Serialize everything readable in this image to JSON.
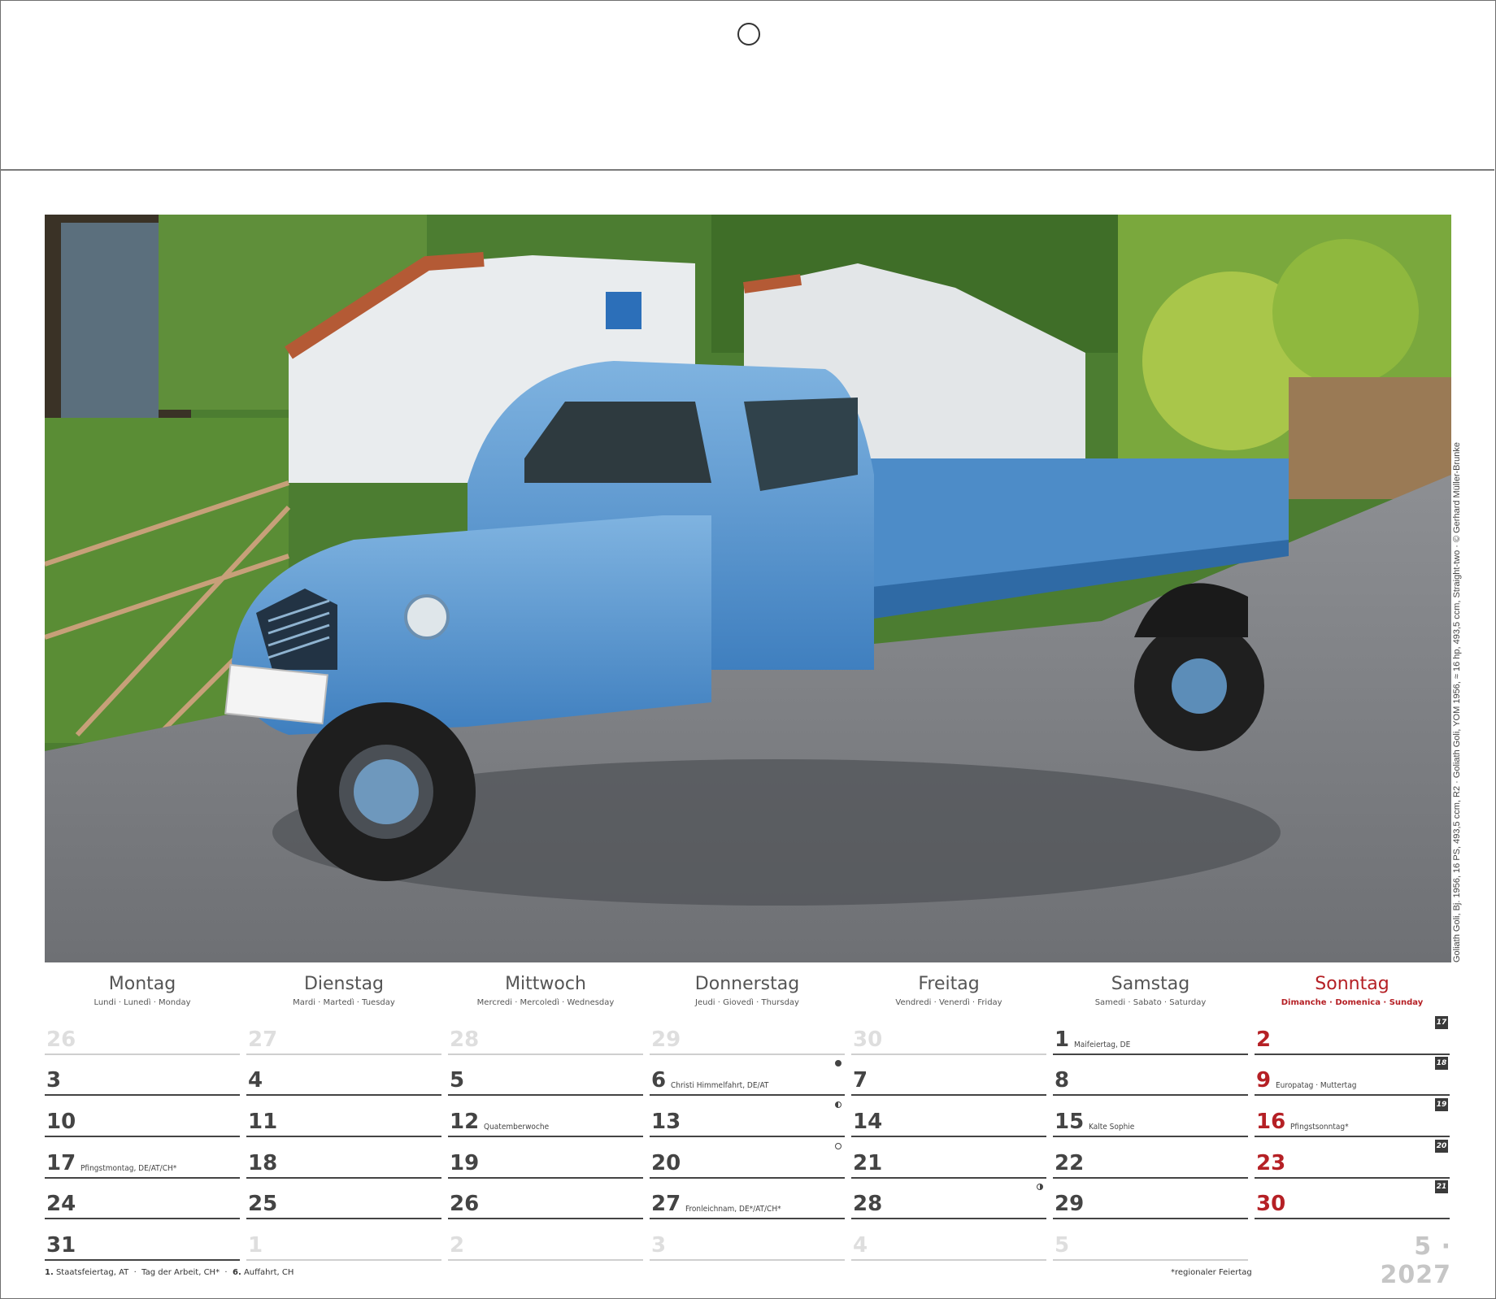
{
  "photo": {
    "subject": "blue three-wheeled Goliath Goli pickup",
    "credit": "Goliath Goli, Bj. 1956, 16 PS, 493,5 ccm, R2 · Goliath Goli, YOM 1956, ≈ 16 hp, 493,5 ccm, Straight-two · © Gerhard Müller-Brunke"
  },
  "weekdays": [
    {
      "name": "Montag",
      "sub": "Lundi · Lunedì · Monday"
    },
    {
      "name": "Dienstag",
      "sub": "Mardi · Martedì · Tuesday"
    },
    {
      "name": "Mittwoch",
      "sub": "Mercredi · Mercoledì · Wednesday"
    },
    {
      "name": "Donnerstag",
      "sub": "Jeudi · Giovedì · Thursday"
    },
    {
      "name": "Freitag",
      "sub": "Vendredi · Venerdì · Friday"
    },
    {
      "name": "Samstag",
      "sub": "Samedi · Sabato · Saturday"
    },
    {
      "name": "Sonntag",
      "sub": "Dimanche · Domenica · Sunday"
    }
  ],
  "weeks": [
    {
      "kw": "17",
      "days": [
        {
          "n": "26",
          "other": true
        },
        {
          "n": "27",
          "other": true
        },
        {
          "n": "28",
          "other": true
        },
        {
          "n": "29",
          "other": true
        },
        {
          "n": "30",
          "other": true
        },
        {
          "n": "1",
          "note": "Maifeiertag, DE"
        },
        {
          "n": "2"
        }
      ]
    },
    {
      "kw": "18",
      "days": [
        {
          "n": "3"
        },
        {
          "n": "4"
        },
        {
          "n": "5"
        },
        {
          "n": "6",
          "note": "Christi Himmelfahrt, DE/AT",
          "moon": "full"
        },
        {
          "n": "7"
        },
        {
          "n": "8"
        },
        {
          "n": "9",
          "note": "Europatag · Muttertag"
        }
      ]
    },
    {
      "kw": "19",
      "days": [
        {
          "n": "10"
        },
        {
          "n": "11"
        },
        {
          "n": "12",
          "note": "Quatemberwoche"
        },
        {
          "n": "13",
          "moon": "last"
        },
        {
          "n": "14"
        },
        {
          "n": "15",
          "note": "Kalte Sophie"
        },
        {
          "n": "16",
          "note": "Pfingstsonntag*"
        }
      ]
    },
    {
      "kw": "20",
      "days": [
        {
          "n": "17",
          "note": "Pfingstmontag, DE/AT/CH*"
        },
        {
          "n": "18"
        },
        {
          "n": "19"
        },
        {
          "n": "20",
          "moon": "new"
        },
        {
          "n": "21"
        },
        {
          "n": "22"
        },
        {
          "n": "23"
        }
      ]
    },
    {
      "kw": "21",
      "days": [
        {
          "n": "24"
        },
        {
          "n": "25"
        },
        {
          "n": "26"
        },
        {
          "n": "27",
          "note": "Fronleichnam, DE*/AT/CH*"
        },
        {
          "n": "28",
          "moon": "first"
        },
        {
          "n": "29"
        },
        {
          "n": "30"
        }
      ]
    },
    {
      "kw": "",
      "days": [
        {
          "n": "31"
        },
        {
          "n": "1",
          "other": true
        },
        {
          "n": "2",
          "other": true
        },
        {
          "n": "3",
          "other": true
        },
        {
          "n": "4",
          "other": true
        },
        {
          "n": "5",
          "other": true
        }
      ]
    }
  ],
  "month_label": "5 · 2027",
  "footer": {
    "h1_num": "1.",
    "h1_text": "Staatsfeiertag, AT",
    "h2_text": "Tag der Arbeit, CH*",
    "h3_num": "6.",
    "h3_text": "Auffahrt, CH",
    "regional": "*regionaler Feiertag"
  },
  "colors": {
    "sunday": "#b52025",
    "grid": "#444444",
    "inactive": "#dedede"
  }
}
